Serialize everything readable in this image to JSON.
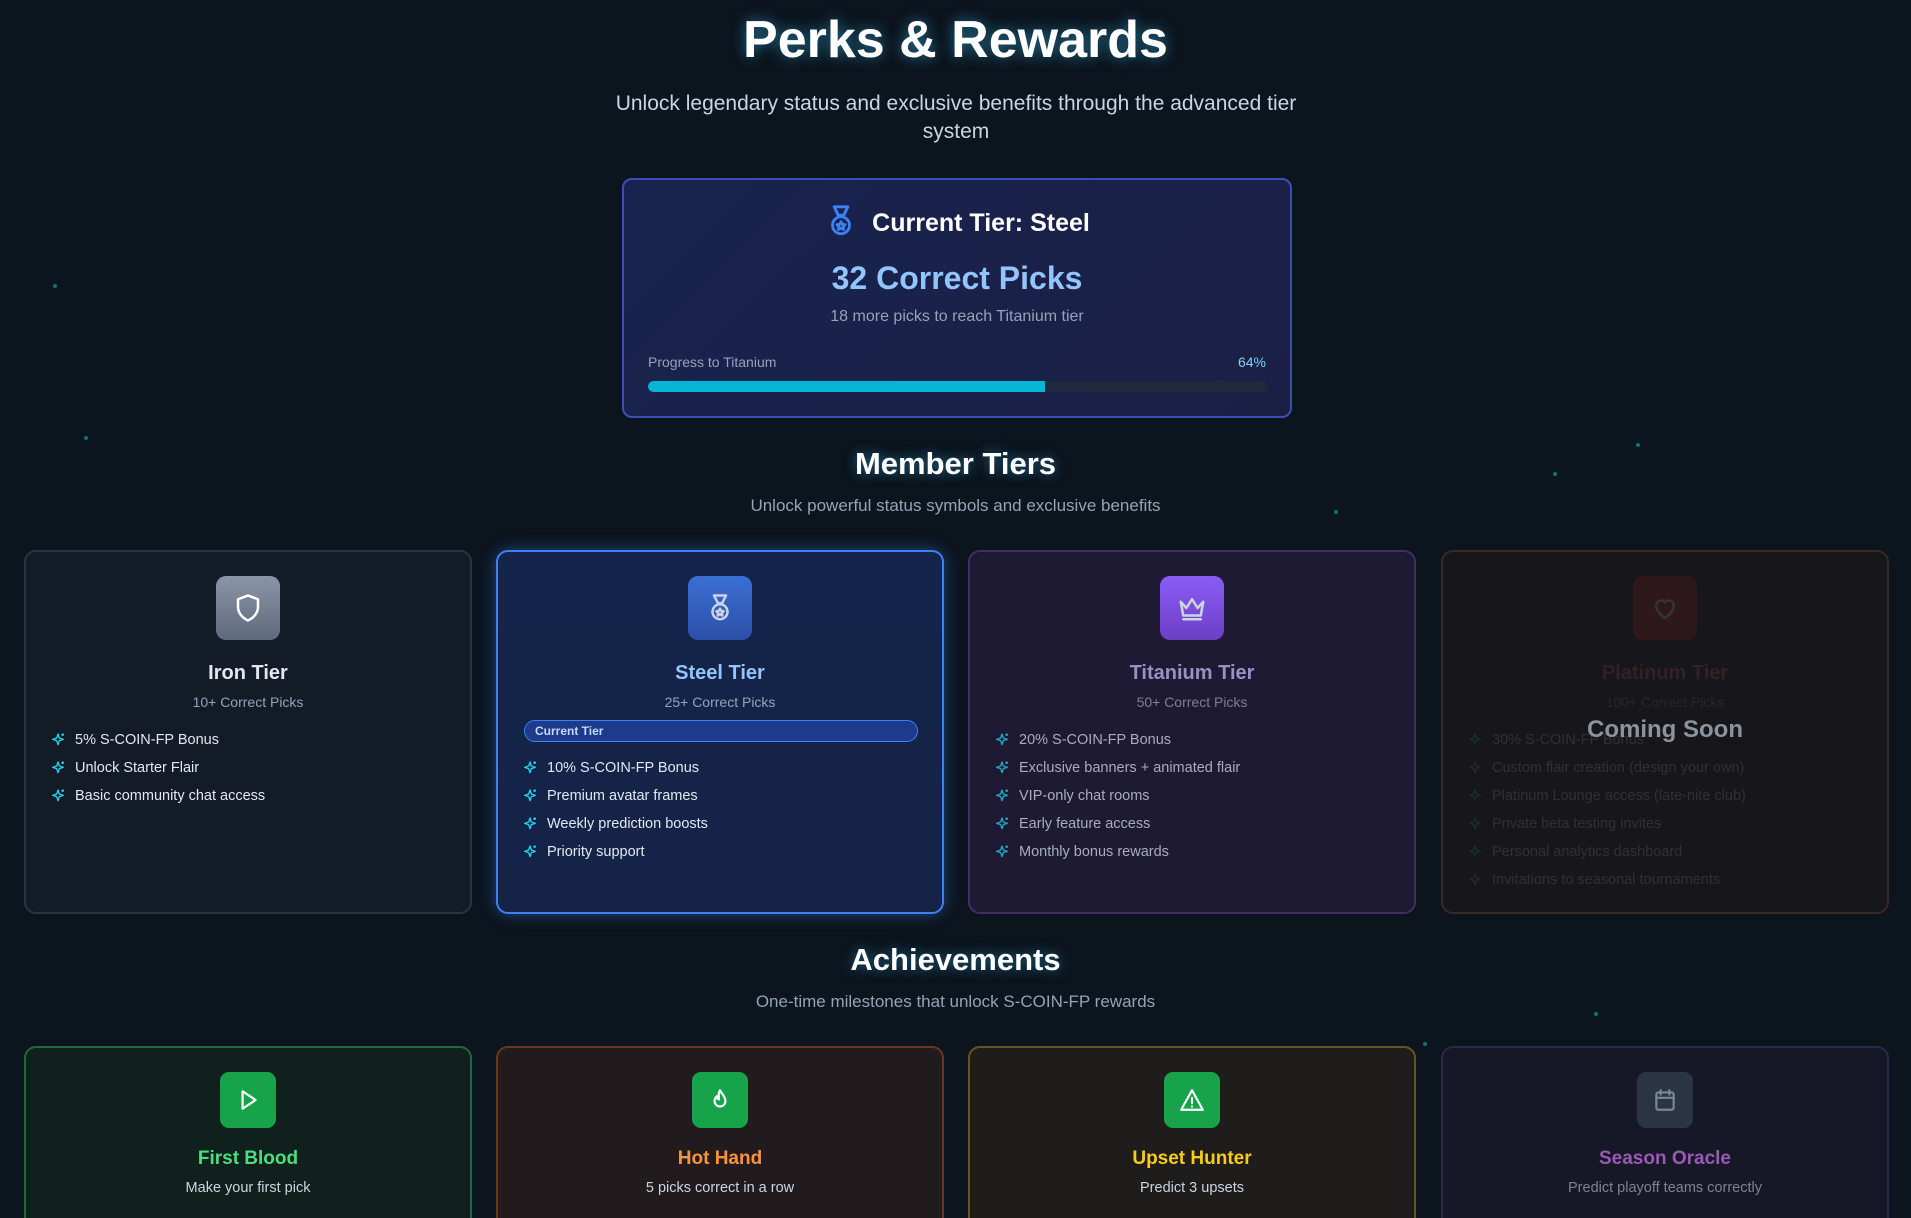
{
  "header": {
    "title": "Perks & Rewards",
    "subtitle": "Unlock legendary status and exclusive benefits through the advanced tier system"
  },
  "current_tier": {
    "title": "Current Tier: Steel",
    "picks": "32 Correct Picks",
    "remaining": "18 more picks to reach Titanium tier",
    "progress_label": "Progress to Titanium",
    "progress_percent": "64%",
    "progress_value": 0.64
  },
  "member_tiers": {
    "title": "Member Tiers",
    "subtitle": "Unlock powerful status symbols and exclusive benefits",
    "tiers": [
      {
        "name": "Iron Tier",
        "requirement": "10+ Correct Picks",
        "icon": "shield-icon",
        "color": "#64748b",
        "perks": [
          "5% S-COIN-FP Bonus",
          "Unlock Starter Flair",
          "Basic community chat access"
        ]
      },
      {
        "name": "Steel Tier",
        "requirement": "25+ Correct Picks",
        "badge": "Current Tier",
        "icon": "medal-icon",
        "color": "#3b82f6",
        "perks": [
          "10% S-COIN-FP Bonus",
          "Premium avatar frames",
          "Weekly prediction boosts",
          "Priority support"
        ]
      },
      {
        "name": "Titanium Tier",
        "requirement": "50+ Correct Picks",
        "icon": "crown-icon",
        "color": "#8b5cf6",
        "perks": [
          "20% S-COIN-FP Bonus",
          "Exclusive banners + animated flair",
          "VIP-only chat rooms",
          "Early feature access",
          "Monthly bonus rewards"
        ]
      },
      {
        "name": "Platinum Tier",
        "requirement": "100+ Correct Picks",
        "icon": "heart-icon",
        "color": "#dc2626",
        "overlay": "Coming Soon",
        "perks": [
          "30% S-COIN-FP Bonus",
          "Custom flair creation (design your own)",
          "Platinum Lounge access (late-nite club)",
          "Private beta testing invites",
          "Personal analytics dashboard",
          "Invitations to seasonal tournaments"
        ]
      }
    ]
  },
  "achievements": {
    "title": "Achievements",
    "subtitle": "One-time milestones that unlock S-COIN-FP rewards",
    "items": [
      {
        "name": "First Blood",
        "description": "Make your first pick",
        "icon": "play-icon",
        "color": "#4ade80"
      },
      {
        "name": "Hot Hand",
        "description": "5 picks correct in a row",
        "icon": "flame-icon",
        "color": "#fb923c"
      },
      {
        "name": "Upset Hunter",
        "description": "Predict 3 upsets",
        "icon": "warning-icon",
        "color": "#facc15"
      },
      {
        "name": "Season Oracle",
        "description": "Predict playoff teams correctly",
        "icon": "calendar-icon",
        "color": "#9b59b6"
      }
    ]
  }
}
